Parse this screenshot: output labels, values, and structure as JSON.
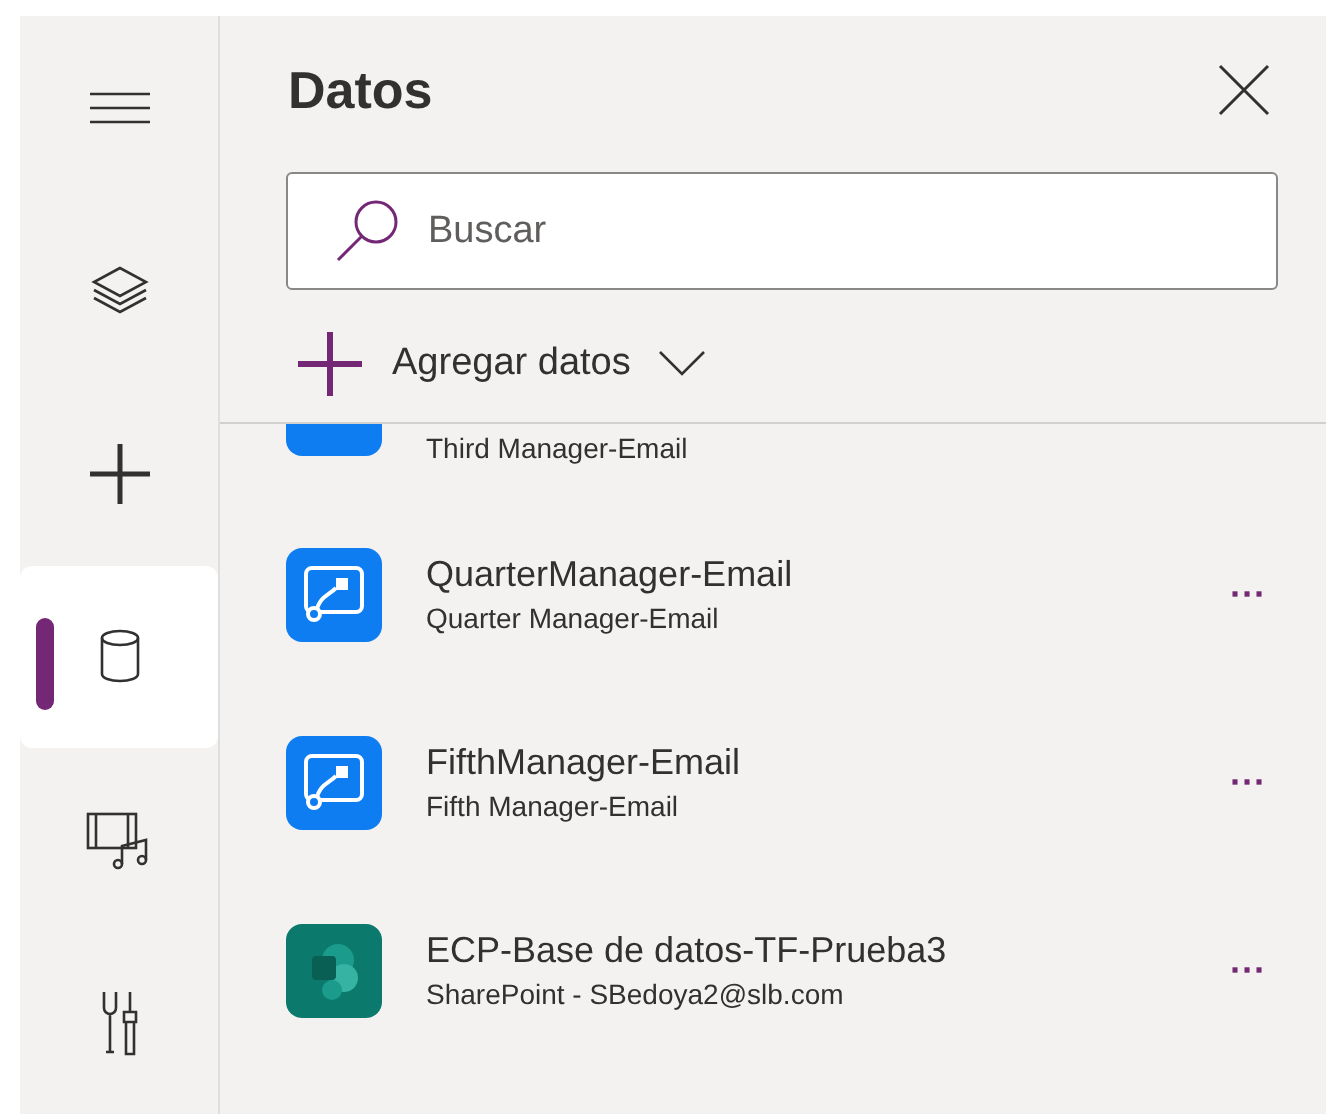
{
  "rail": [
    {
      "kind": "menu",
      "selected": false
    },
    {
      "kind": "layers",
      "selected": false
    },
    {
      "kind": "insert",
      "selected": false
    },
    {
      "kind": "data",
      "selected": true
    },
    {
      "kind": "media",
      "selected": false
    },
    {
      "kind": "tools",
      "selected": false
    }
  ],
  "panel": {
    "title": "Datos",
    "search": {
      "placeholder": "Buscar"
    },
    "add_button": "Agregar datos"
  },
  "items": [
    {
      "kind": "flow",
      "partial": true,
      "subtitle": "Third Manager-Email"
    },
    {
      "kind": "flow",
      "partial": false,
      "name": "QuarterManager-Email",
      "subtitle": "Quarter Manager-Email",
      "more": "···"
    },
    {
      "kind": "flow",
      "partial": false,
      "name": "FifthManager-Email",
      "subtitle": "Fifth Manager-Email",
      "more": "···"
    },
    {
      "kind": "sharepoint",
      "partial": false,
      "name": "ECP-Base de datos-TF-Prueba3",
      "subtitle": "SharePoint - SBedoya2@slb.com",
      "more": "···"
    }
  ]
}
